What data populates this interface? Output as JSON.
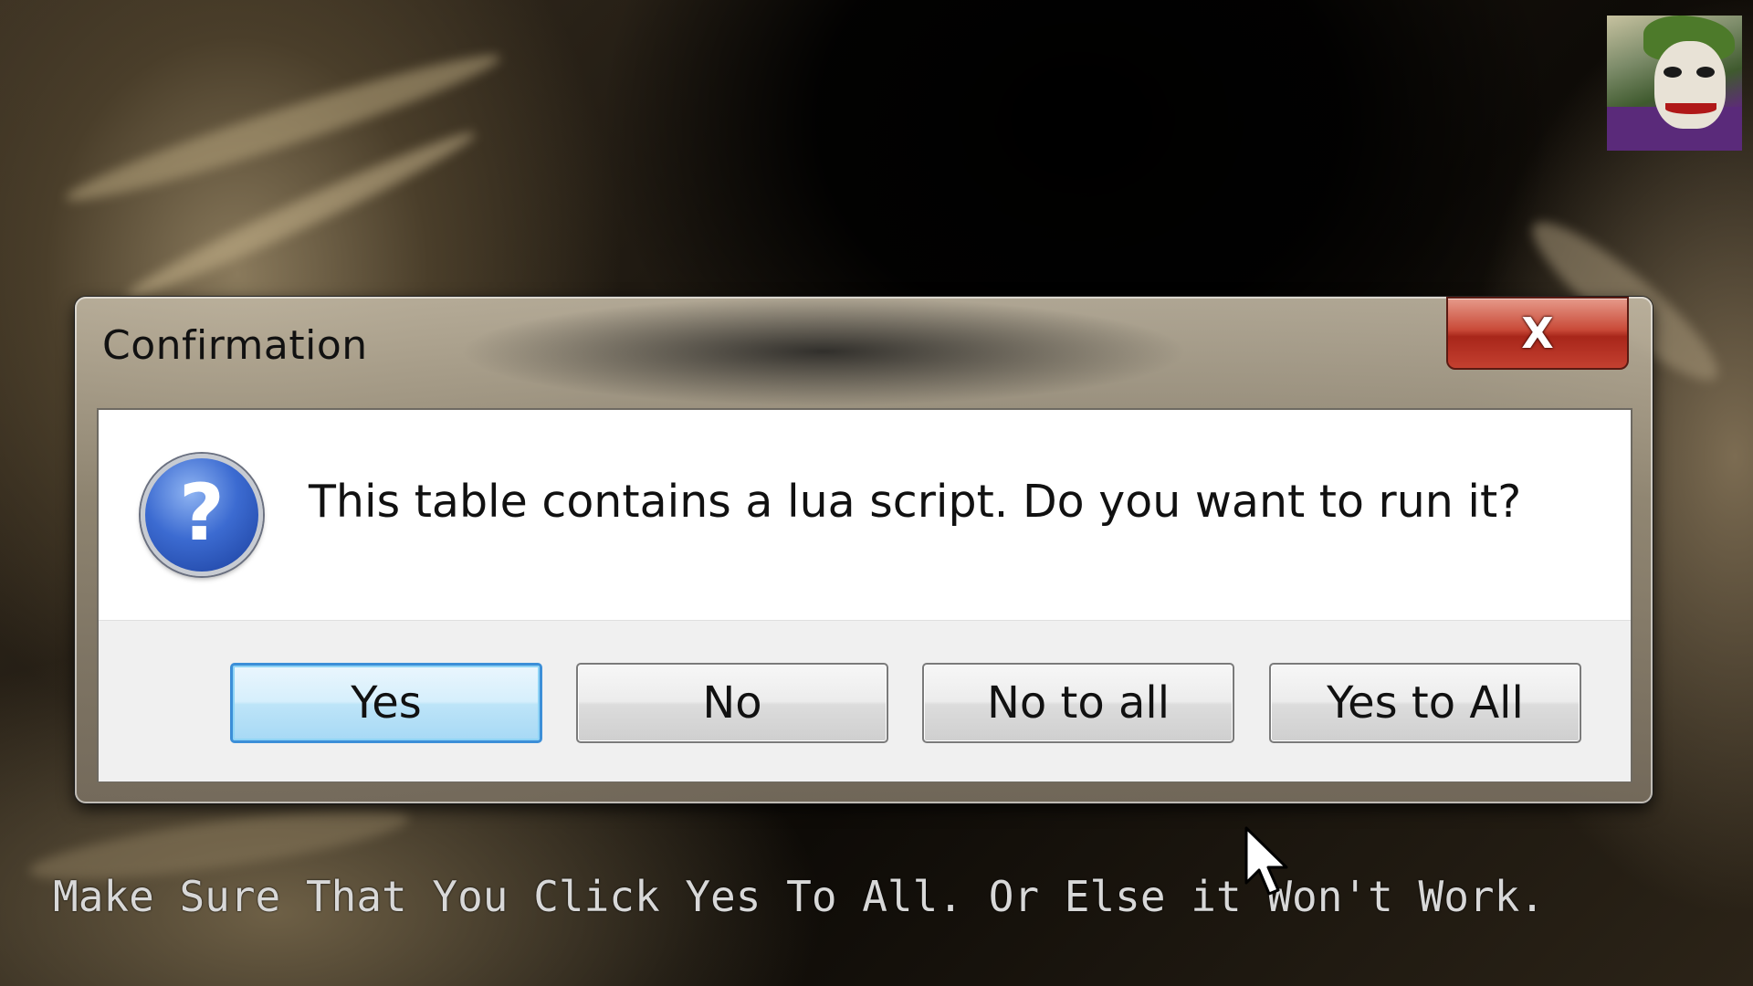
{
  "dialog": {
    "title": "Confirmation",
    "close_label": "X",
    "icon": "question-icon",
    "message": "This table contains a lua script. Do you want to run it?",
    "buttons": {
      "yes": "Yes",
      "no": "No",
      "no_to_all": "No to all",
      "yes_to_all": "Yes to All"
    },
    "default_button": "yes"
  },
  "overlay": {
    "caption": "Make Sure That You Click Yes To All. Or Else it Won't Work."
  },
  "colors": {
    "close_button": "#c94a38",
    "default_button_border": "#3c8fd8",
    "question_icon": "#3c6bd1",
    "caption_text": "#d8d8d8"
  }
}
